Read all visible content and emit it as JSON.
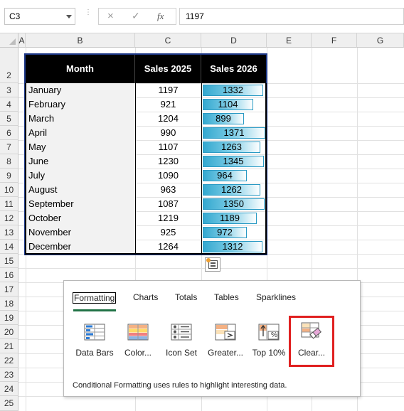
{
  "formula_bar": {
    "name_box": "C3",
    "formula": "1197",
    "cancel_icon": "×",
    "enter_icon": "✓",
    "fx_icon": "fx"
  },
  "columns": [
    "A",
    "B",
    "C",
    "D",
    "E",
    "F",
    "G"
  ],
  "rows": [
    "2",
    "3",
    "4",
    "5",
    "6",
    "7",
    "8",
    "9",
    "10",
    "11",
    "12",
    "13",
    "14",
    "15",
    "16",
    "17",
    "18",
    "19",
    "20",
    "21",
    "22",
    "23",
    "24",
    "25"
  ],
  "table": {
    "headers": [
      "Month",
      "Sales 2025",
      "Sales 2026"
    ],
    "months": [
      "January",
      "February",
      "March",
      "April",
      "May",
      "June",
      "July",
      "August",
      "September",
      "October",
      "November",
      "December"
    ],
    "sales_2025": [
      "1197",
      "921",
      "1204",
      "990",
      "1107",
      "1230",
      "1090",
      "963",
      "1087",
      "1219",
      "925",
      "1264"
    ],
    "sales_2026": [
      1332,
      1104,
      899,
      1371,
      1263,
      1345,
      964,
      1262,
      1350,
      1189,
      972,
      1312
    ],
    "bar_max": 1371,
    "bar_color": "#34a9d0"
  },
  "quick_analysis": {
    "tabs": [
      "Formatting",
      "Charts",
      "Totals",
      "Tables",
      "Sparklines"
    ],
    "options": [
      "Data Bars",
      "Color...",
      "Icon Set",
      "Greater...",
      "Top 10%",
      "Clear..."
    ],
    "description": "Conditional Formatting uses rules to highlight interesting data.",
    "top10_badge": "%",
    "highlight_color": "#e02020"
  }
}
